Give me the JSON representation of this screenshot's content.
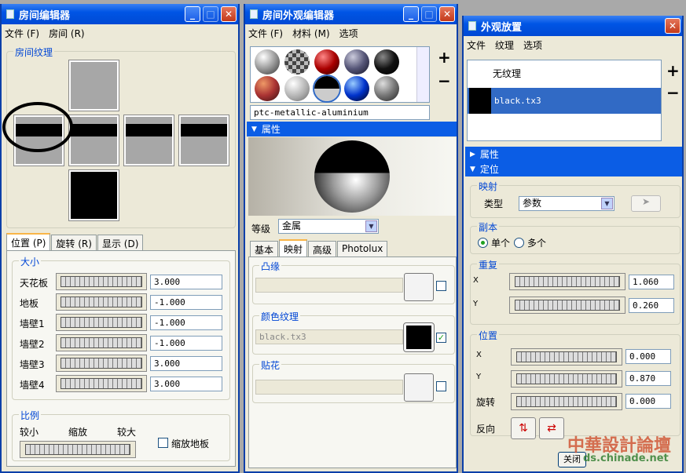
{
  "room_editor": {
    "title": "房间编辑器",
    "menu": [
      "文件 (F)",
      "房间 (R)"
    ],
    "group_texture": "房间纹理",
    "tabs": [
      "位置 (P)",
      "旋转 (R)",
      "显示 (D)"
    ],
    "size_group": "大小",
    "rows": [
      {
        "label": "天花板",
        "value": "3.000"
      },
      {
        "label": "地板",
        "value": "-1.000"
      },
      {
        "label": "墙壁1",
        "value": "-1.000"
      },
      {
        "label": "墙壁2",
        "value": "-1.000"
      },
      {
        "label": "墙壁3",
        "value": "3.000"
      },
      {
        "label": "墙壁4",
        "value": "3.000"
      }
    ],
    "scale_group": "比例",
    "scale_labels": [
      "较小",
      "缩放",
      "较大"
    ],
    "scale_floor": "缩放地板"
  },
  "appearance_editor": {
    "title": "房间外观编辑器",
    "menu": [
      "文件 (F)",
      "材料 (M)",
      "选项"
    ],
    "material_name": "ptc-metallic-aluminium",
    "plus": "+",
    "minus": "−",
    "properties_header": "属性",
    "grade_label": "等级",
    "grade_value": "金属",
    "tabs": [
      "基本",
      "映射",
      "高级",
      "Photolux"
    ],
    "bump_group": "凸缘",
    "color_group": "颜色纹理",
    "color_file": "black.tx3",
    "decal_group": "贴花"
  },
  "placement": {
    "title": "外观放置",
    "menu": [
      "文件",
      "纹理",
      "选项"
    ],
    "list": [
      "无纹理",
      "black.tx3"
    ],
    "plus": "+",
    "minus": "−",
    "prop_header": "属性",
    "pos_header": "定位",
    "mapping_group": "映射",
    "type_label": "类型",
    "type_value": "参数",
    "copy_group": "副本",
    "single": "单个",
    "multiple": "多个",
    "repeat_group": "重复",
    "repeat": [
      {
        "axis": "X",
        "value": "1.060"
      },
      {
        "axis": "Y",
        "value": "0.260"
      }
    ],
    "position_group": "位置",
    "position": [
      {
        "axis": "X",
        "value": "0.000"
      },
      {
        "axis": "Y",
        "value": "0.870"
      },
      {
        "axis": "旋转",
        "value": "0.000"
      }
    ],
    "reverse_label": "反向",
    "close_button": "关闭"
  },
  "watermark": {
    "text": "中華設計論壇",
    "url": "ds.chinade.net"
  }
}
